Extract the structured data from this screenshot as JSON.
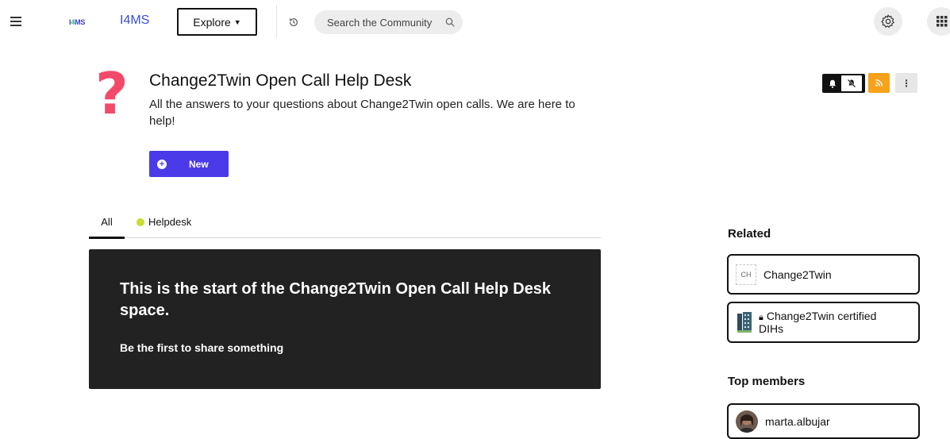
{
  "topbar": {
    "menu_icon": "hamburger-icon",
    "logo_text_prefix": "I",
    "logo_text_four": "4",
    "logo_text_suffix": "MS",
    "brand_link": "I4MS",
    "explore_label": "Explore",
    "search_placeholder": "Search the Community",
    "settings_icon": "gear-icon",
    "apps_icon": "grid-icon"
  },
  "space": {
    "icon": "question-mark",
    "title": "Change2Twin Open Call Help Desk",
    "description": "All the answers to your questions about Change2Twin open calls. We are here to help!",
    "new_button": "New"
  },
  "tabs": [
    {
      "label": "All",
      "active": true
    },
    {
      "label": "Helpdesk",
      "dot_color": "#c8dc33"
    }
  ],
  "empty_state": {
    "title": "This is the start of the Change2Twin Open Call Help Desk space.",
    "subtitle": "Be the first to share something"
  },
  "sidebar": {
    "related_heading": "Related",
    "related": [
      {
        "avatar_text": "CH",
        "label": "Change2Twin"
      },
      {
        "label": "Change2Twin certified DIHs",
        "locked": true
      }
    ],
    "members_heading": "Top members",
    "members": [
      {
        "name": "marta.albujar"
      }
    ]
  },
  "colors": {
    "accent": "#4a3ae8",
    "brand_link": "#3b4cd8",
    "question_mark": "#f34a6a",
    "rss": "#f7a21b",
    "empty_card": "#222222"
  }
}
